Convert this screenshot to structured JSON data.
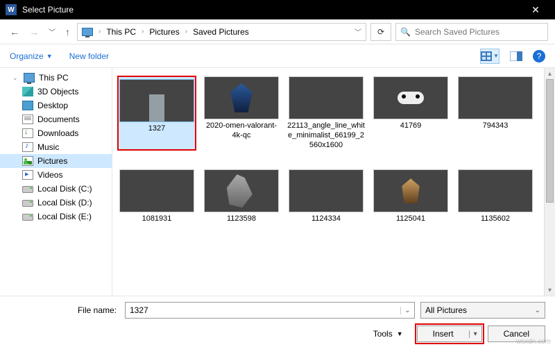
{
  "titlebar": {
    "title": "Select Picture",
    "app_icon_text": "W"
  },
  "nav": {
    "breadcrumb": [
      "This PC",
      "Pictures",
      "Saved Pictures"
    ],
    "search_placeholder": "Search Saved Pictures"
  },
  "toolbar": {
    "organize": "Organize",
    "new_folder": "New folder"
  },
  "sidebar": {
    "items": [
      {
        "label": "This PC",
        "icon": "monitor",
        "expandable": true,
        "level": 0
      },
      {
        "label": "3D Objects",
        "icon": "cube",
        "level": 1
      },
      {
        "label": "Desktop",
        "icon": "desktop",
        "level": 1
      },
      {
        "label": "Documents",
        "icon": "doc",
        "level": 1
      },
      {
        "label": "Downloads",
        "icon": "down",
        "level": 1
      },
      {
        "label": "Music",
        "icon": "music",
        "level": 1
      },
      {
        "label": "Pictures",
        "icon": "pic",
        "level": 1,
        "selected": true
      },
      {
        "label": "Videos",
        "icon": "vid",
        "level": 1
      },
      {
        "label": "Local Disk (C:)",
        "icon": "disk",
        "level": 1
      },
      {
        "label": "Local Disk (D:)",
        "icon": "disk",
        "level": 1
      },
      {
        "label": "Local Disk (E:)",
        "icon": "disk",
        "level": 1
      }
    ]
  },
  "files": {
    "row1": [
      {
        "name": "1327",
        "art": "1327",
        "selected": true
      },
      {
        "name": "2020-omen-valorant-4k-qc",
        "art": "omen"
      },
      {
        "name": "22113_angle_line_white_minimalist_66199_2560x1600",
        "art": "angle"
      },
      {
        "name": "41769",
        "art": "41769"
      },
      {
        "name": "794343",
        "art": "794343"
      }
    ],
    "row2": [
      {
        "name": "1081931",
        "art": "1081931"
      },
      {
        "name": "1123598",
        "art": "1123598"
      },
      {
        "name": "1124334",
        "art": "1124334"
      },
      {
        "name": "1125041",
        "art": "1125041"
      },
      {
        "name": "1135602",
        "art": "1135602"
      }
    ]
  },
  "bottom": {
    "file_name_label": "File name:",
    "file_name_value": "1327",
    "filter": "All Pictures",
    "tools": "Tools",
    "insert": "Insert",
    "cancel": "Cancel"
  },
  "watermark": "wsxdn.com"
}
